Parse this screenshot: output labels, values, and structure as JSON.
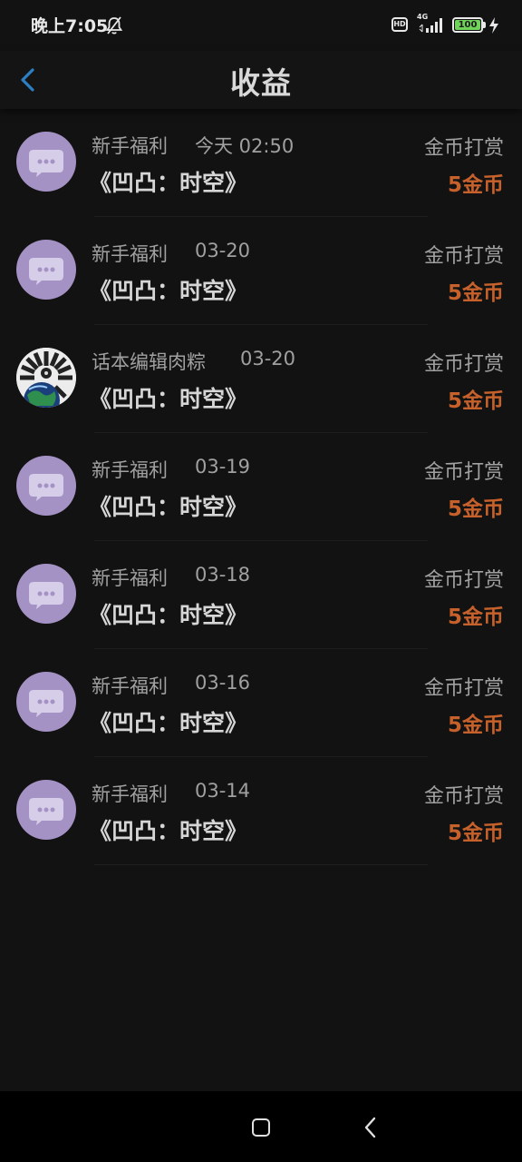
{
  "status_bar": {
    "time": "晚上7:05",
    "hd": "HD",
    "network": "4G",
    "battery": "100",
    "battery_color": "#6fd35a"
  },
  "header": {
    "title": "收益",
    "back_icon": "chevron-left-icon",
    "accent": "#2d7fc4"
  },
  "records": [
    {
      "source": "新手福利",
      "date": "今天 02:50",
      "book": "《凹凸：时空》",
      "type": "金币打赏",
      "amount": "5金币",
      "avatar": "chat-bubble-avatar"
    },
    {
      "source": "新手福利",
      "date": "03-20",
      "book": "《凹凸：时空》",
      "type": "金币打赏",
      "amount": "5金币",
      "avatar": "chat-bubble-avatar"
    },
    {
      "source": "话本编辑肉粽",
      "date": "03-20",
      "book": "《凹凸：时空》",
      "type": "金币打赏",
      "amount": "5金币",
      "avatar": "earth-avatar"
    },
    {
      "source": "新手福利",
      "date": "03-19",
      "book": "《凹凸：时空》",
      "type": "金币打赏",
      "amount": "5金币",
      "avatar": "chat-bubble-avatar"
    },
    {
      "source": "新手福利",
      "date": "03-18",
      "book": "《凹凸：时空》",
      "type": "金币打赏",
      "amount": "5金币",
      "avatar": "chat-bubble-avatar"
    },
    {
      "source": "新手福利",
      "date": "03-16",
      "book": "《凹凸：时空》",
      "type": "金币打赏",
      "amount": "5金币",
      "avatar": "chat-bubble-avatar"
    },
    {
      "source": "新手福利",
      "date": "03-14",
      "book": "《凹凸：时空》",
      "type": "金币打赏",
      "amount": "5金币",
      "avatar": "chat-bubble-avatar"
    }
  ],
  "colors": {
    "amount": "#c7612c",
    "avatar_bg": "#a592c5"
  },
  "nav_bar": {
    "home_icon": "square-home-icon",
    "back_icon": "back-arrow-icon"
  }
}
